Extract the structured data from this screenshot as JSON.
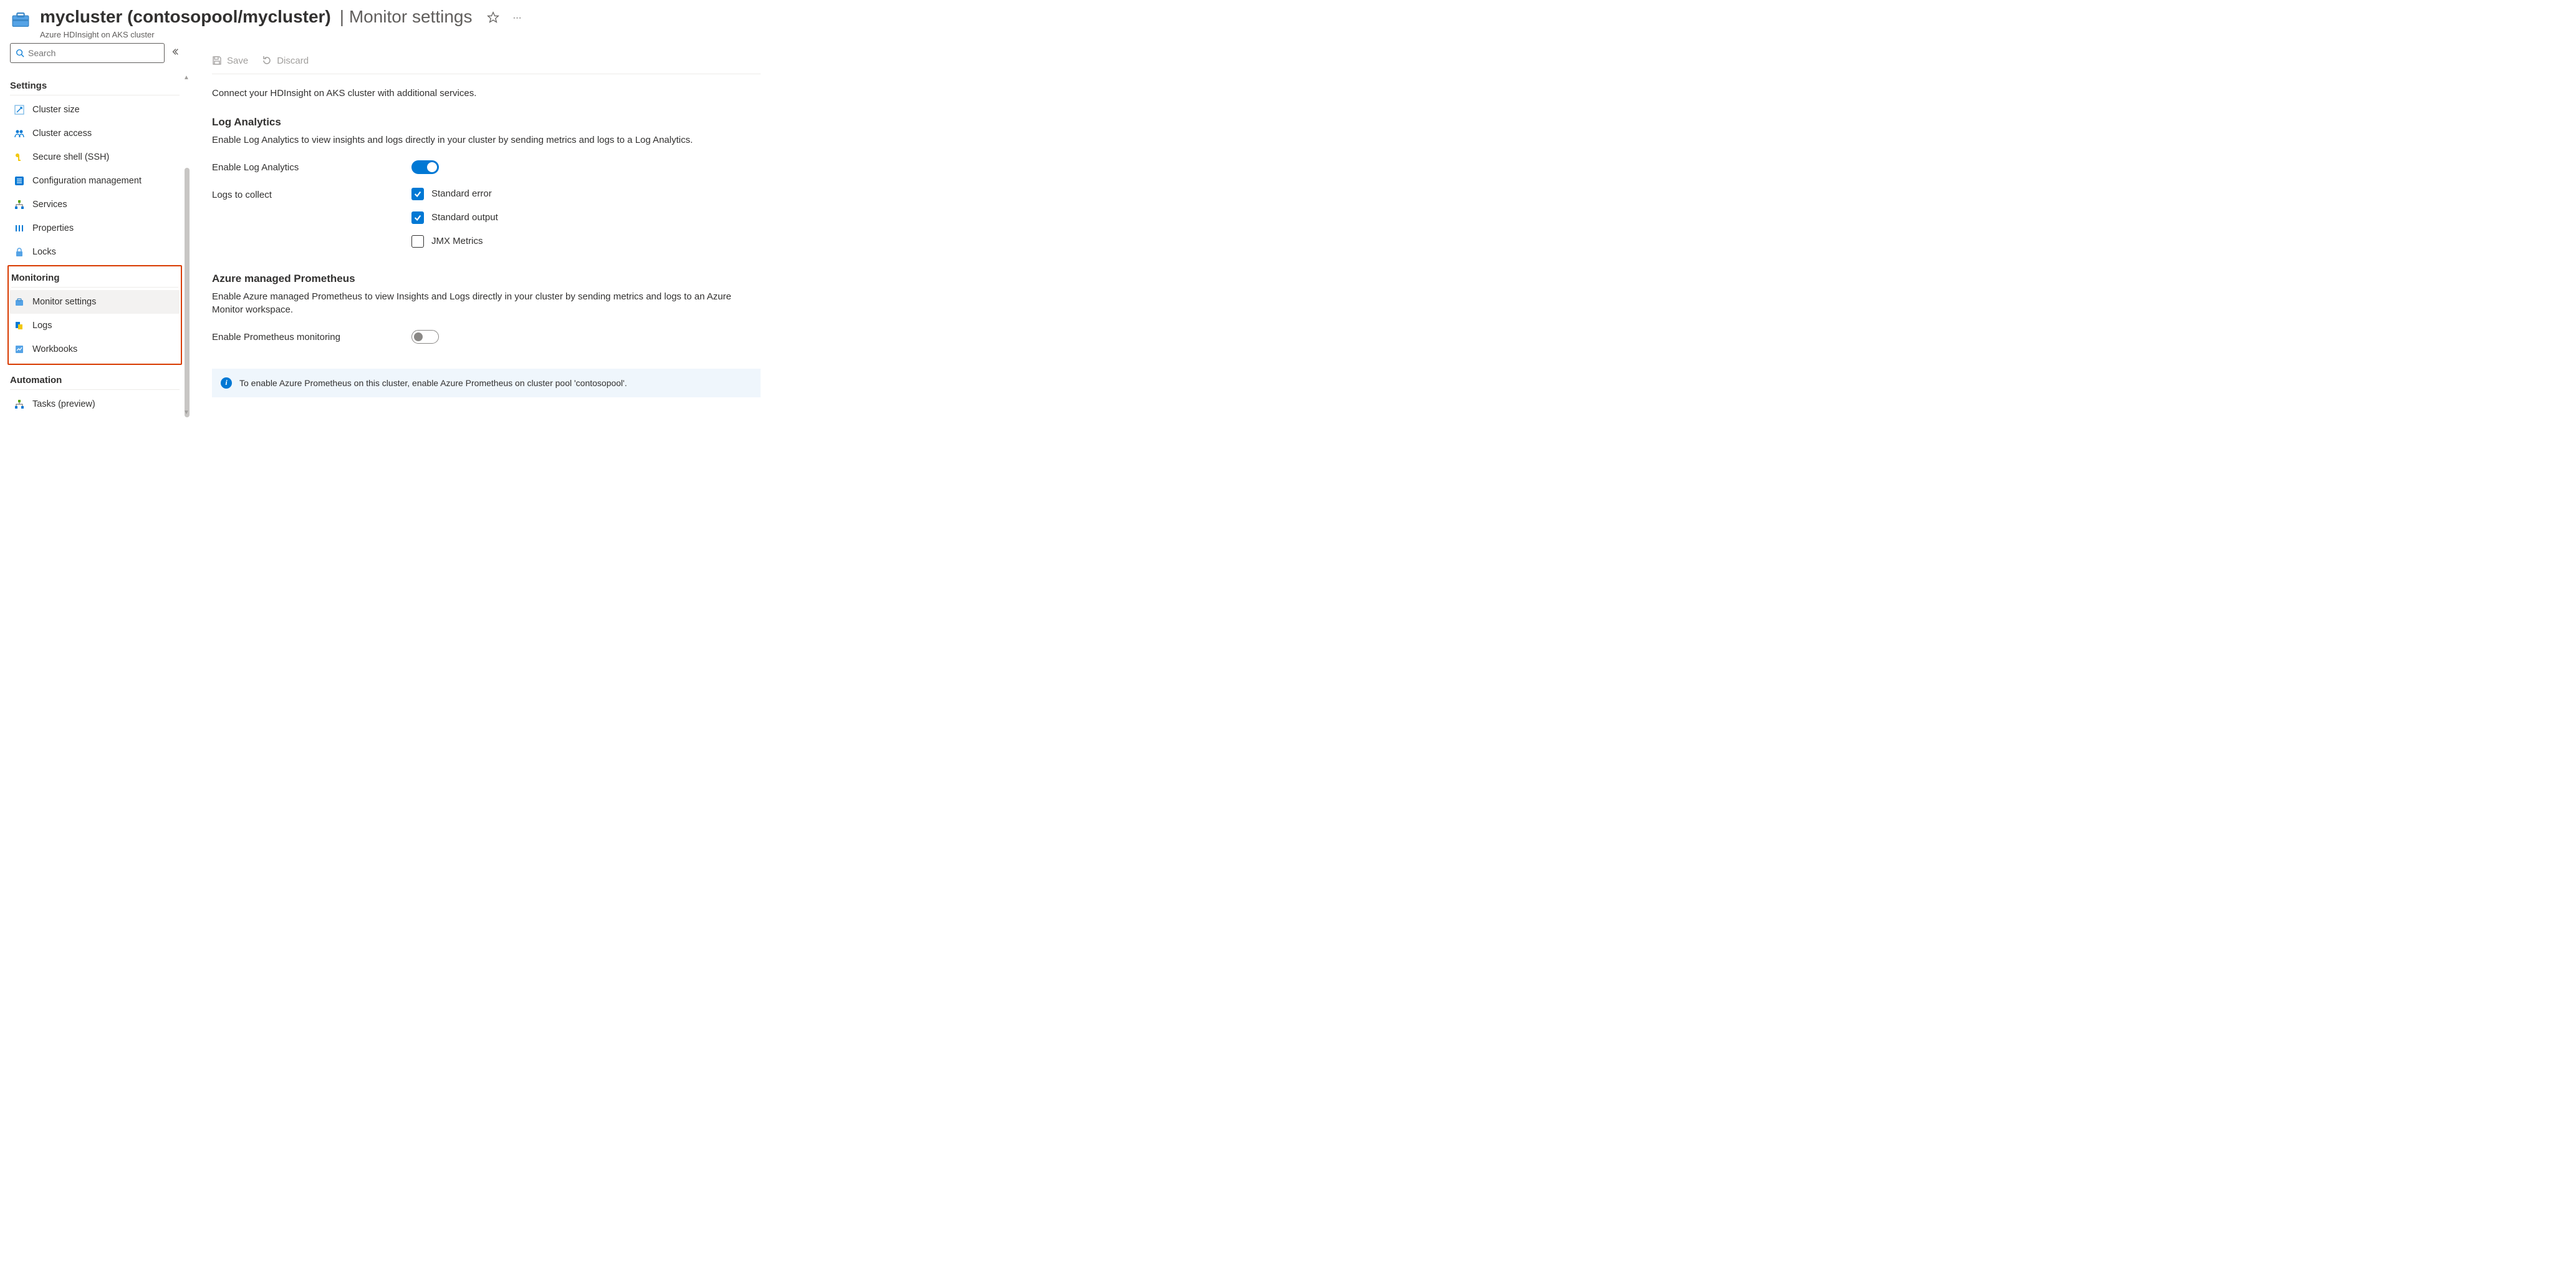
{
  "header": {
    "title_main": "mycluster (contosopool/mycluster)",
    "title_sub": "Monitor settings",
    "subtitle": "Azure HDInsight on AKS cluster"
  },
  "sidebar": {
    "search_placeholder": "Search",
    "sections": [
      {
        "title": "Settings",
        "items": [
          {
            "label": "Cluster size",
            "icon": "resize-icon"
          },
          {
            "label": "Cluster access",
            "icon": "people-icon"
          },
          {
            "label": "Secure shell (SSH)",
            "icon": "key-icon"
          },
          {
            "label": "Configuration management",
            "icon": "checklist-icon"
          },
          {
            "label": "Services",
            "icon": "hierarchy-icon"
          },
          {
            "label": "Properties",
            "icon": "bars-icon"
          },
          {
            "label": "Locks",
            "icon": "lock-icon"
          }
        ]
      },
      {
        "title": "Monitoring",
        "highlighted": true,
        "items": [
          {
            "label": "Monitor settings",
            "icon": "briefcase-icon",
            "active": true
          },
          {
            "label": "Logs",
            "icon": "logs-icon"
          },
          {
            "label": "Workbooks",
            "icon": "workbook-icon"
          }
        ]
      },
      {
        "title": "Automation",
        "items": [
          {
            "label": "Tasks (preview)",
            "icon": "tasks-icon"
          }
        ]
      }
    ]
  },
  "toolbar": {
    "save_label": "Save",
    "discard_label": "Discard"
  },
  "content": {
    "intro": "Connect your HDInsight on AKS cluster with additional services.",
    "logAnalytics": {
      "title": "Log Analytics",
      "desc": "Enable Log Analytics to view insights and logs directly in your cluster by sending metrics and logs to a Log Analytics.",
      "enable_label": "Enable Log Analytics",
      "enabled": true,
      "logs_label": "Logs to collect",
      "options": [
        {
          "label": "Standard error",
          "checked": true
        },
        {
          "label": "Standard output",
          "checked": true
        },
        {
          "label": "JMX Metrics",
          "checked": false
        }
      ]
    },
    "prometheus": {
      "title": "Azure managed Prometheus",
      "desc": "Enable Azure managed Prometheus to view Insights and Logs directly in your cluster by sending metrics and logs to an Azure Monitor workspace.",
      "enable_label": "Enable Prometheus monitoring",
      "enabled": false,
      "banner": "To enable Azure Prometheus on this cluster, enable Azure Prometheus on cluster pool 'contosopool'."
    }
  }
}
